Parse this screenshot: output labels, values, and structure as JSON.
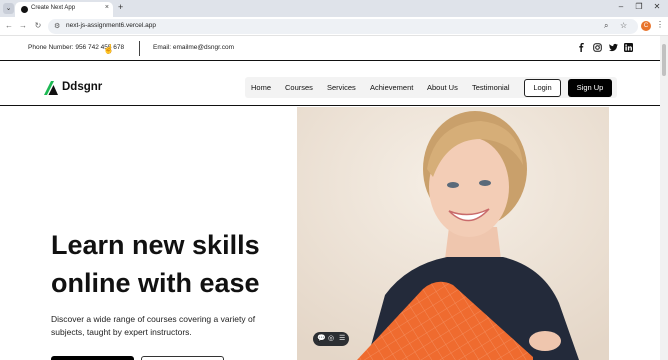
{
  "browser": {
    "tab_title": "Create Next App",
    "tab_close": "×",
    "new_tab": "+",
    "tab_list": "⌄",
    "url": "next-js-assignment6.vercel.app",
    "site_info_icon": "⚙",
    "profile_initial": "C",
    "window_controls": {
      "minimize": "–",
      "maximize": "❐",
      "close": "✕"
    },
    "nav": {
      "back": "←",
      "forward": "→",
      "reload": "↻"
    },
    "omni_icons": {
      "zoom": "⌕",
      "bookmark": "☆"
    },
    "menu": "⋮"
  },
  "topbar": {
    "phone": "Phone Number: 956 742 455 678",
    "email": "Email: emailme@dsngr.com",
    "social": [
      "facebook-icon",
      "instagram-icon",
      "twitter-icon",
      "linkedin-icon"
    ]
  },
  "navbar": {
    "brand": "Ddsgnr",
    "menu_items": [
      "Home",
      "Courses",
      "Services",
      "Achievement",
      "About Us",
      "Testimonial"
    ],
    "login": "Login",
    "signup": "Sign Up"
  },
  "hero": {
    "title": "Learn new skills online with ease",
    "subtitle": "Discover a wide range of courses covering a variety of subjects, taught by expert instructors."
  },
  "media_toolbar": {
    "icons": [
      "💬",
      "◎",
      "☰"
    ]
  },
  "colors": {
    "brand_green": "#1db954",
    "primary_black": "#000000",
    "hero_bg": "#efe6dc",
    "folder_orange": "#ef6b2f"
  }
}
